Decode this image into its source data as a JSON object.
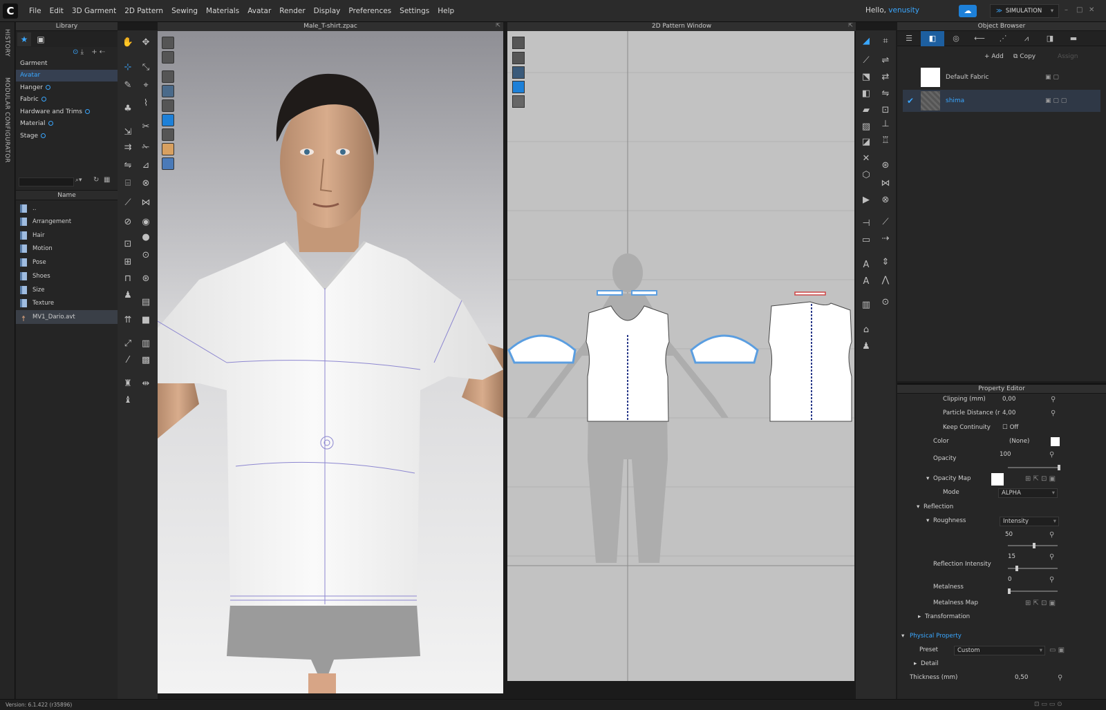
{
  "app": {
    "logo": "C"
  },
  "menu": [
    "File",
    "Edit",
    "3D Garment",
    "2D Pattern",
    "Sewing",
    "Materials",
    "Avatar",
    "Render",
    "Display",
    "Preferences",
    "Settings",
    "Help"
  ],
  "user": {
    "greeting": "Hello,",
    "name": "venusity"
  },
  "simulation_label": "SIMULATION",
  "side_tabs": {
    "history": "HISTORY",
    "modular": "MODULAR CONFIGURATOR"
  },
  "library": {
    "title": "Library",
    "tree": [
      {
        "label": "Garment",
        "dot": false
      },
      {
        "label": "Avatar",
        "dot": false,
        "selected": true
      },
      {
        "label": "Hanger",
        "dot": true
      },
      {
        "label": "Fabric",
        "dot": true
      },
      {
        "label": "Hardware and Trims",
        "dot": true
      },
      {
        "label": "Material",
        "dot": true
      },
      {
        "label": "Stage",
        "dot": true
      }
    ],
    "name_header": "Name",
    "files": [
      "..",
      "Arrangement",
      "Hair",
      "Motion",
      "Pose",
      "Shoes",
      "Size",
      "Texture",
      "MV1_Dario.avt"
    ]
  },
  "view3d": {
    "title": "Male_T-shirt.zpac"
  },
  "view2d": {
    "title": "2D Pattern Window"
  },
  "object_browser": {
    "title": "Object Browser",
    "add_label": "Add",
    "copy_label": "Copy",
    "assign_label": "Assign",
    "fabrics": [
      {
        "name": "Default Fabric",
        "selected": false
      },
      {
        "name": "shima",
        "selected": true
      }
    ]
  },
  "property_editor": {
    "title": "Property Editor",
    "rows": {
      "clipping": {
        "label": "Clipping (mm)",
        "value": "0,00"
      },
      "particle": {
        "label": "Particle Distance (r",
        "value": "4,00"
      },
      "keep": {
        "label": "Keep Continuity",
        "value": "Off"
      },
      "color": {
        "label": "Color",
        "value": "(None)"
      },
      "opacity": {
        "label": "Opacity",
        "value": "100"
      },
      "opacity_map": {
        "label": "Opacity Map"
      },
      "mode": {
        "label": "Mode",
        "value": "ALPHA"
      },
      "reflection": {
        "label": "Reflection"
      },
      "roughness": {
        "label": "Roughness",
        "mode": "Intensity",
        "value": "50"
      },
      "refl_intensity": {
        "label": "Reflection Intensity",
        "value": "15"
      },
      "metalness": {
        "label": "Metalness",
        "value": "0"
      },
      "metal_map": {
        "label": "Metalness Map"
      },
      "transformation": {
        "label": "Transformation"
      },
      "physical": {
        "label": "Physical Property"
      },
      "preset": {
        "label": "Preset",
        "value": "Custom"
      },
      "detail": {
        "label": "Detail"
      },
      "thickness": {
        "label": "Thickness (mm)",
        "value": "0,50"
      }
    },
    "sliders": {
      "opacity": 1.0,
      "roughness": 0.5,
      "refl_intensity": 0.15,
      "metalness": 0.0
    }
  },
  "status": {
    "version": "Version: 6.1.422 (r35896)"
  },
  "colors": {
    "accent": "#3aa7ff",
    "panel": "#262626",
    "selected": "#364051"
  }
}
